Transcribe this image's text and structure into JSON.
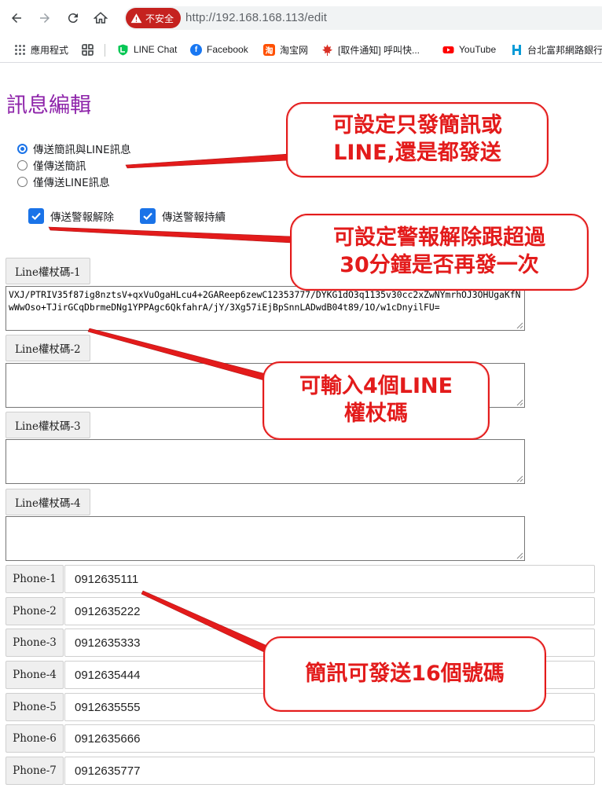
{
  "browser": {
    "security_label": "不安全",
    "url": "http://192.168.168.113/edit",
    "bookmarks": [
      {
        "label": "應用程式",
        "icon": "apps-grid-icon"
      },
      {
        "label": "",
        "icon": "grid-icon"
      },
      {
        "label": "LINE Chat",
        "icon": "line-shield-icon",
        "color": "#06c755"
      },
      {
        "label": "Facebook",
        "icon": "facebook-icon",
        "color": "#1877f2"
      },
      {
        "label": "淘宝网",
        "icon": "taobao-icon",
        "color": "#ff5000"
      },
      {
        "label": "[取件通知] 呼叫快...",
        "icon": "maple-leaf-icon",
        "color": "#d93025"
      },
      {
        "label": "YouTube",
        "icon": "youtube-icon",
        "color": "#ff0000"
      },
      {
        "label": "台北富邦網路銀行",
        "icon": "fubon-icon",
        "color": "#0b9bd7"
      }
    ]
  },
  "page": {
    "title": "訊息編輯",
    "send_mode_options": [
      {
        "label": "傳送簡訊與LINE訊息",
        "checked": true
      },
      {
        "label": "僅傳送簡訊",
        "checked": false
      },
      {
        "label": "僅傳送LINE訊息",
        "checked": false
      }
    ],
    "alarm_options": [
      {
        "label": "傳送警報解除",
        "checked": true
      },
      {
        "label": "傳送警報持續",
        "checked": true
      }
    ],
    "line_tokens": [
      {
        "label": "Line權杖碼-1",
        "value": "VXJ/PTRIV35f87ig8nztsV+qxVuOgaHLcu4+2GAReep6zewC12353777/DYKG1dO3q1135v30cc2xZwNYmrhOJ3OHUgaKfNwWwOso+TJirGCqDbrmeDNg1YPPAgc6QkfahrA/jY/3Xg57iEjBpSnnLADwdB04t89/1O/w1cDnyilFU="
      },
      {
        "label": "Line權杖碼-2",
        "value": ""
      },
      {
        "label": "Line權杖碼-3",
        "value": ""
      },
      {
        "label": "Line權杖碼-4",
        "value": ""
      }
    ],
    "phones": [
      {
        "label": "Phone-1",
        "value": "0912635111"
      },
      {
        "label": "Phone-2",
        "value": "0912635222"
      },
      {
        "label": "Phone-3",
        "value": "0912635333"
      },
      {
        "label": "Phone-4",
        "value": "0912635444"
      },
      {
        "label": "Phone-5",
        "value": "0912635555"
      },
      {
        "label": "Phone-6",
        "value": "0912635666"
      },
      {
        "label": "Phone-7",
        "value": "0912635777"
      }
    ]
  },
  "annotations": {
    "send_mode": [
      "可設定只發簡訊或",
      "LINE,還是都發送"
    ],
    "alarm": [
      "可設定警報解除跟超過",
      "30分鐘是否再發一次"
    ],
    "line_tokens": [
      "可輸入4個LINE",
      "權杖碼"
    ],
    "phones": [
      "簡訊可發送16個號碼"
    ]
  },
  "colors": {
    "annotation_red": "#e31b1b",
    "title_purple": "#8e24aa",
    "accent_blue": "#1a73e8",
    "insecure_red": "#c5221f"
  }
}
